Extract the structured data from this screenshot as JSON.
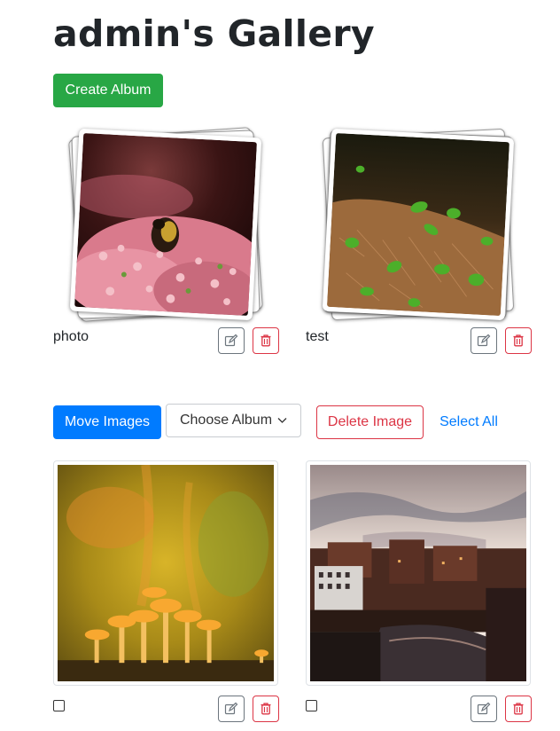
{
  "header": {
    "title": "admin's Gallery"
  },
  "actions": {
    "create_album": "Create Album"
  },
  "albums": [
    {
      "name": "photo"
    },
    {
      "name": "test"
    }
  ],
  "toolbar": {
    "move_images": "Move Images",
    "choose_album": "Choose Album",
    "delete_image": "Delete Image",
    "select_all": "Select All"
  },
  "colors": {
    "success": "#28a745",
    "primary": "#007bff",
    "danger": "#dc3545",
    "secondary": "#6c757d"
  },
  "icons": {
    "edit": "pencil-square-icon",
    "delete": "trash-icon",
    "dropdown": "chevron-down-icon"
  }
}
